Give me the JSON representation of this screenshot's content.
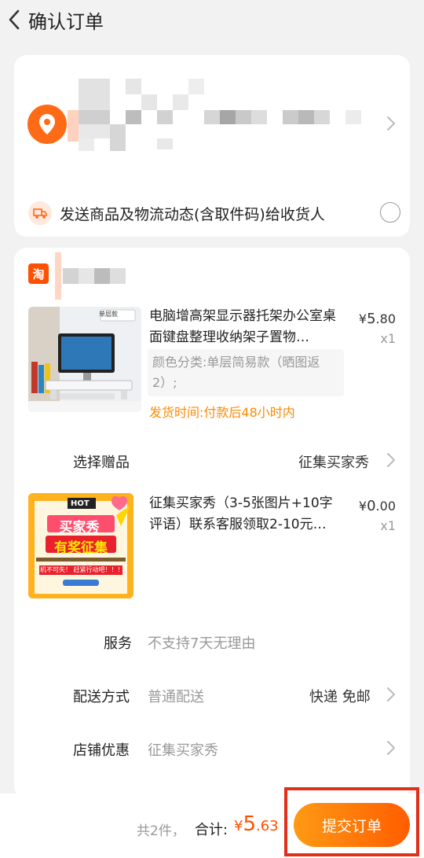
{
  "header": {
    "title": "确认订单"
  },
  "address": {
    "notify_text": "发送商品及物流动态(含取件码)给收货人"
  },
  "shop": {
    "badge": "淘"
  },
  "products": [
    {
      "title": "电脑增高架显示器托架办公室桌面键盘整理收纳架子置物…",
      "spec": "颜色分类:单层简易款（晒图返2）;",
      "price_symbol": "¥",
      "price_int": "5",
      "price_dec": ".80",
      "qty": "x1",
      "ship_time": "发货时间:付款后48小时内",
      "image_label_top": "单层款"
    },
    {
      "title": "征集买家秀（3-5张图片+10字评语）联系客服领取2-10元…",
      "price_symbol": "¥",
      "price_int": "0",
      "price_dec": ".00",
      "qty": "x1",
      "image_hot": "HOT",
      "image_line1": "买家秀",
      "image_line2": "有奖征集",
      "image_slogan": "机不可失！ 赶紧行动吧！！！"
    }
  ],
  "gift": {
    "label": "选择赠品",
    "value": "征集买家秀"
  },
  "rows": {
    "service_label": "服务",
    "service_value": "不支持7天无理由",
    "delivery_label": "配送方式",
    "delivery_value": "普通配送",
    "delivery_right": "快递 免邮",
    "coupon_label": "店铺优惠",
    "coupon_value": "征集买家秀"
  },
  "footer": {
    "count": "共2件，",
    "total_label": "合计:",
    "currency": "¥",
    "total_int": "5",
    "total_dec": ".63",
    "submit": "提交订单"
  },
  "colors": {
    "accent": "#ff5000",
    "ship": "#ff8a00"
  }
}
